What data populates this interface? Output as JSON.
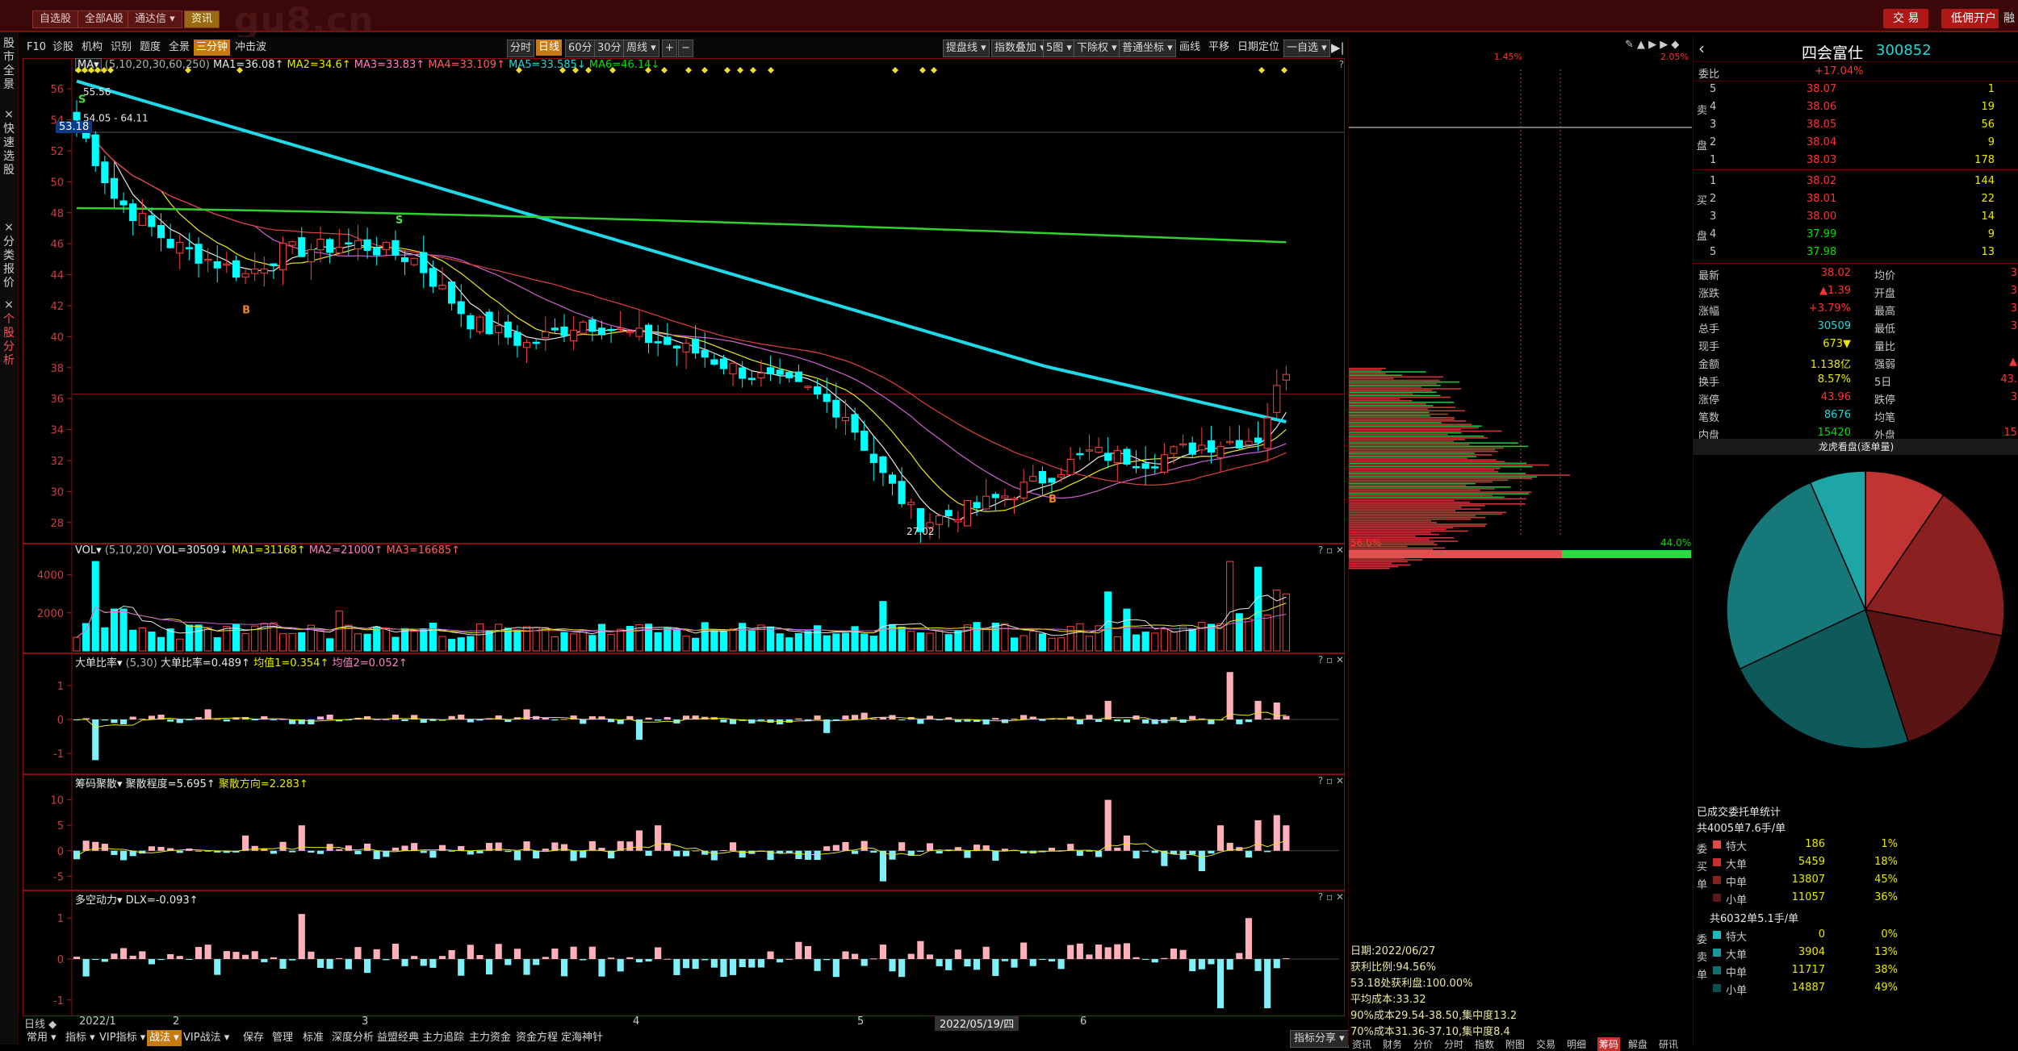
{
  "topbar": {
    "buttons": [
      "自选股",
      "全部A股",
      "通达信 ▾",
      "资讯"
    ],
    "watermark": "gu8.cn",
    "right_buttons": [
      "交 易",
      "低佣开户"
    ],
    "corner": "融"
  },
  "left_tabs": [
    "股市全景",
    "快速选股",
    "分类报价",
    "个股分析"
  ],
  "toolbar": {
    "items": [
      "F10",
      "诊股",
      "机构",
      "识别",
      "题度",
      "全景",
      "三分钟",
      "冲击波",
      "分时",
      "日线",
      "60分",
      "30分",
      "周线 ▾",
      "+",
      "−"
    ],
    "right_items": [
      "提盘线 ▾",
      "指数叠加 ▾",
      "5图 ▾",
      "下除权 ▾",
      "普通坐标 ▾",
      "画线",
      "平移",
      "日期定位",
      "一自选 ▾"
    ]
  },
  "main_chart": {
    "indicator": "MA▾",
    "params": "(5,10,20,30,60,250)",
    "ma_values": [
      "MA1=36.08↑",
      "MA2=34.6↑",
      "MA3=33.83↑",
      "MA4=33.109↑",
      "MA5=33.585↓",
      "MA6=46.14↓"
    ],
    "y_ticks": [
      "56",
      "54",
      "52",
      "50",
      "48",
      "46",
      "44",
      "42",
      "40",
      "38",
      "36",
      "34",
      "32",
      "30",
      "28"
    ],
    "current_price_tag": "53.18",
    "annotations": [
      "55.56",
      "54.05 - 64.11",
      "27.02",
      "B",
      "S"
    ]
  },
  "vol_panel": {
    "indicator": "VOL▾",
    "params": "(5,10,20)",
    "values": [
      "VOL=30509↓",
      "MA1=31168↑",
      "MA2=21000↑",
      "MA3=16685↑"
    ],
    "y_ticks": [
      "4000",
      "2000"
    ]
  },
  "ratio_panel": {
    "indicator": "大单比率▾",
    "params": "(5,30)",
    "values": [
      "大单比率=0.489↑",
      "均值1=0.354↑",
      "均值2=0.052↑"
    ],
    "y_ticks": [
      "1",
      "0",
      "-1"
    ]
  },
  "chip_panel": {
    "indicator": "筹码聚散▾",
    "values": [
      "聚散程度=5.695↑",
      "聚散方向=2.283↑"
    ],
    "y_ticks": [
      "10",
      "5",
      "0",
      "-5"
    ]
  },
  "dk_panel": {
    "indicator": "多空动力▾",
    "values": [
      "DLX=-0.093↑"
    ],
    "y_ticks": [
      "1",
      "0",
      "-1"
    ]
  },
  "x_axis": {
    "left": "日线 ◆",
    "labels": [
      "2022/1",
      "2",
      "3",
      "4",
      "5",
      "2022/05/19/四",
      "6"
    ]
  },
  "bottom_tabs": [
    "常用 ▾",
    "指标 ▾",
    "VIP指标 ▾",
    "战法 ▾",
    "VIP战法 ▾",
    "保存",
    "管理",
    "标准",
    "深度分析",
    "益盟经典",
    "主力追踪",
    "主力资金",
    "资金方程",
    "定海神针"
  ],
  "bottom_right": "指标分享 ▾",
  "mid_panel": {
    "top_labels": [
      "1.45%",
      "2.05%"
    ],
    "left_pct": "56.0%",
    "right_pct": "44.0%",
    "stats": [
      "日期:2022/06/27",
      "获利比例:94.56%",
      "53.18处获利盘:100.00%",
      "平均成本:33.32",
      "90%成本29.54-38.50,集中度13.2",
      "70%成本31.36-37.10,集中度8.4"
    ],
    "bottom_tabs": [
      "资讯",
      "财务",
      "分价",
      "分时",
      "指数",
      "附图",
      "交易",
      "明细",
      "筹码",
      "解盘",
      "研讯"
    ]
  },
  "quote": {
    "name": "四会富仕",
    "code": "300852",
    "webi_label": "委比",
    "webi_value": "+17.04%",
    "sell": [
      {
        "tag": "5",
        "price": "38.07",
        "vol": "1"
      },
      {
        "tag": "4",
        "price": "38.06",
        "vol": "19"
      },
      {
        "tag": "3",
        "price": "38.05",
        "vol": "56"
      },
      {
        "tag": "2",
        "price": "38.04",
        "vol": "9"
      },
      {
        "tag": "1",
        "price": "38.03",
        "vol": "178"
      }
    ],
    "buy": [
      {
        "tag": "1",
        "price": "38.02",
        "vol": "144"
      },
      {
        "tag": "2",
        "price": "38.01",
        "vol": "22"
      },
      {
        "tag": "3",
        "price": "38.00",
        "vol": "14"
      },
      {
        "tag": "4",
        "price": "37.99",
        "vol": "9"
      },
      {
        "tag": "5",
        "price": "37.98",
        "vol": "13"
      }
    ],
    "side_sell": [
      "卖",
      "盘"
    ],
    "side_buy": [
      "买",
      "盘"
    ],
    "info": [
      {
        "l": "最新",
        "v": "38.02",
        "l2": "均价",
        "v2": "3"
      },
      {
        "l": "涨跌",
        "v": "▲1.39",
        "l2": "开盘",
        "v2": "3"
      },
      {
        "l": "涨幅",
        "v": "+3.79%",
        "l2": "最高",
        "v2": "3"
      },
      {
        "l": "总手",
        "v": "30509",
        "l2": "最低",
        "v2": "3"
      },
      {
        "l": "现手",
        "v": "673▼",
        "l2": "量比",
        "v2": ""
      },
      {
        "l": "金额",
        "v": "1.138亿",
        "l2": "强弱",
        "v2": "▲"
      },
      {
        "l": "换手",
        "v": "8.57%",
        "l2": "5日",
        "v2": "43."
      },
      {
        "l": "涨停",
        "v": "43.96",
        "l2": "跌停",
        "v2": "3"
      },
      {
        "l": "笔数",
        "v": "8676",
        "l2": "均笔",
        "v2": ""
      },
      {
        "l": "内盘",
        "v": "15420",
        "l2": "外盘",
        "v2": "15"
      }
    ],
    "pie_title": "龙虎看盘(逐单量)",
    "order_stat_title": "已成交委托单统计",
    "buy_total": "共4005单7.6手/单",
    "buy_side": [
      "委",
      "买",
      "单"
    ],
    "buy_rows": [
      {
        "label": "特大",
        "vol": "186",
        "pct": "1%",
        "color": "#e04a4a"
      },
      {
        "label": "大单",
        "vol": "5459",
        "pct": "18%",
        "color": "#c83030"
      },
      {
        "label": "中单",
        "vol": "13807",
        "pct": "45%",
        "color": "#8a2020"
      },
      {
        "label": "小单",
        "vol": "11057",
        "pct": "36%",
        "color": "#5a1818"
      }
    ],
    "sell_total": "共6032单5.1手/单",
    "sell_side": [
      "委",
      "卖",
      "单"
    ],
    "sell_rows": [
      {
        "label": "特大",
        "vol": "0",
        "pct": "0%",
        "color": "#20b8b8"
      },
      {
        "label": "大单",
        "vol": "3904",
        "pct": "13%",
        "color": "#189898"
      },
      {
        "label": "中单",
        "vol": "11717",
        "pct": "38%",
        "color": "#107070"
      },
      {
        "label": "小单",
        "vol": "14887",
        "pct": "49%",
        "color": "#0a5050"
      }
    ]
  },
  "colors": {
    "up": "#ff4040",
    "down": "#00ffff",
    "ma60": "#20d8e8",
    "ma250": "#30d030",
    "panel_border": "#8a1010"
  }
}
